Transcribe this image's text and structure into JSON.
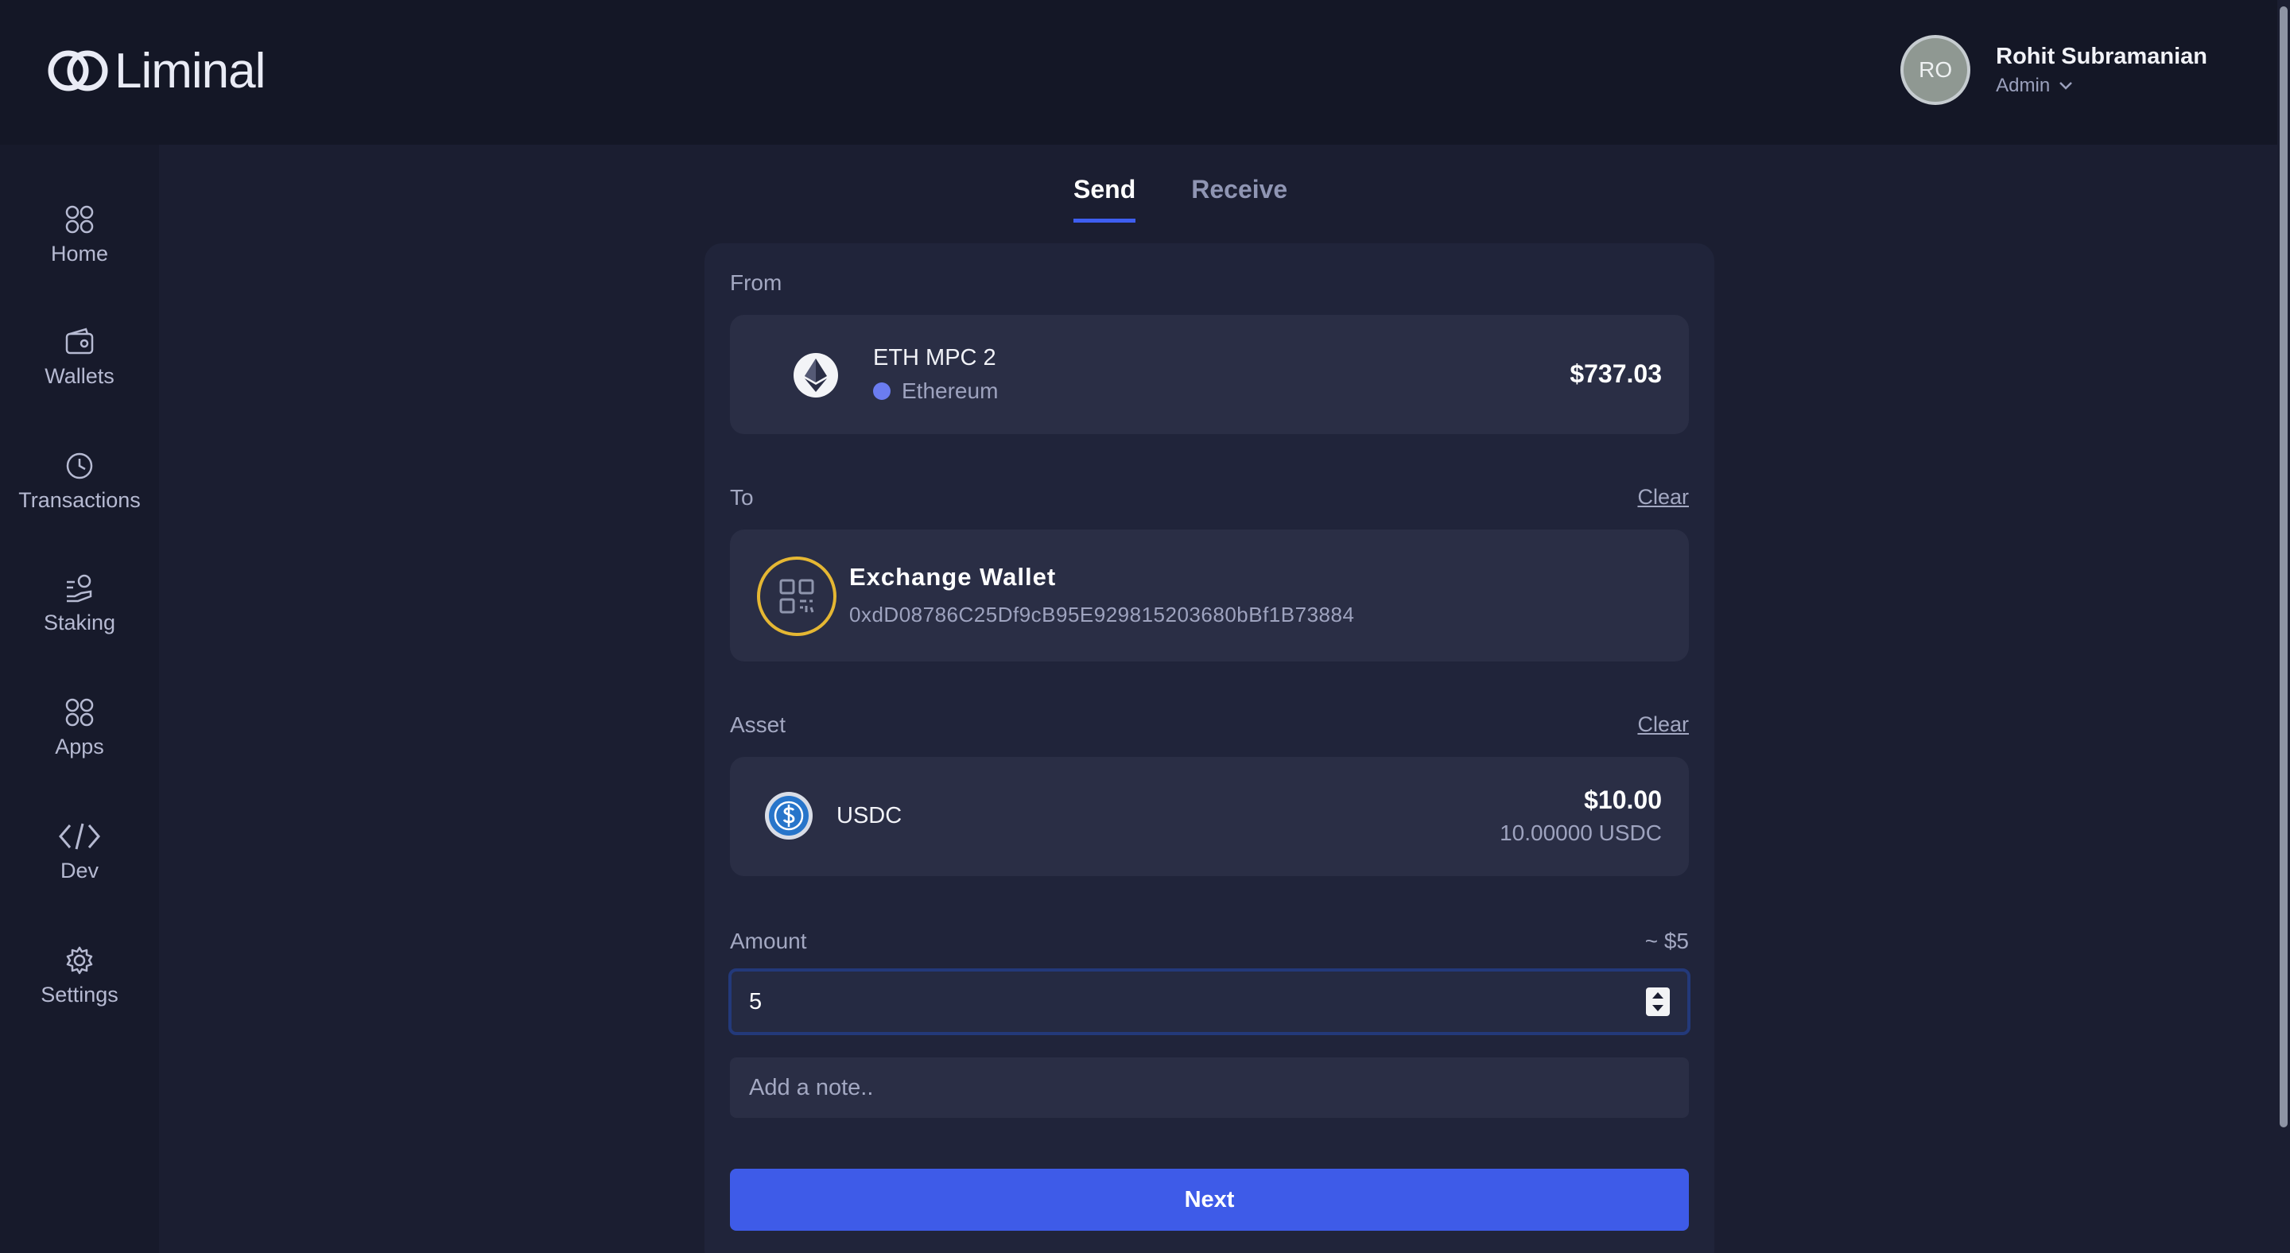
{
  "app": {
    "brand": "Liminal"
  },
  "user": {
    "initials": "RO",
    "name": "Rohit Subramanian",
    "role": "Admin"
  },
  "sidebar": {
    "items": [
      {
        "label": "Home",
        "icon": "grid-icon"
      },
      {
        "label": "Wallets",
        "icon": "wallet-icon"
      },
      {
        "label": "Transactions",
        "icon": "clock-icon"
      },
      {
        "label": "Staking",
        "icon": "staking-icon"
      },
      {
        "label": "Apps",
        "icon": "grid-icon"
      },
      {
        "label": "Dev",
        "icon": "code-icon"
      },
      {
        "label": "Settings",
        "icon": "gear-icon"
      }
    ]
  },
  "tabs": [
    {
      "label": "Send",
      "active": true
    },
    {
      "label": "Receive",
      "active": false
    }
  ],
  "form": {
    "from": {
      "label": "From",
      "wallet_name": "ETH MPC 2",
      "network": "Ethereum",
      "balance": "$737.03"
    },
    "to": {
      "label": "To",
      "clear_label": "Clear",
      "wallet_name": "Exchange Wallet",
      "address": "0xdD08786C25Df9cB95E929815203680bBf1B73884"
    },
    "asset": {
      "label": "Asset",
      "clear_label": "Clear",
      "name": "USDC",
      "value_usd": "$10.00",
      "amount": "10.00000 USDC"
    },
    "amount": {
      "label": "Amount",
      "estimate": "~ $5",
      "value": "5"
    },
    "note": {
      "placeholder": "Add a note.."
    },
    "next_label": "Next"
  },
  "colors": {
    "accent": "#3e5be8",
    "background": "#1b1e31",
    "panel": "#2a2e45",
    "qr_ring": "#e5b733",
    "network_dot": "#6b7cf0"
  }
}
